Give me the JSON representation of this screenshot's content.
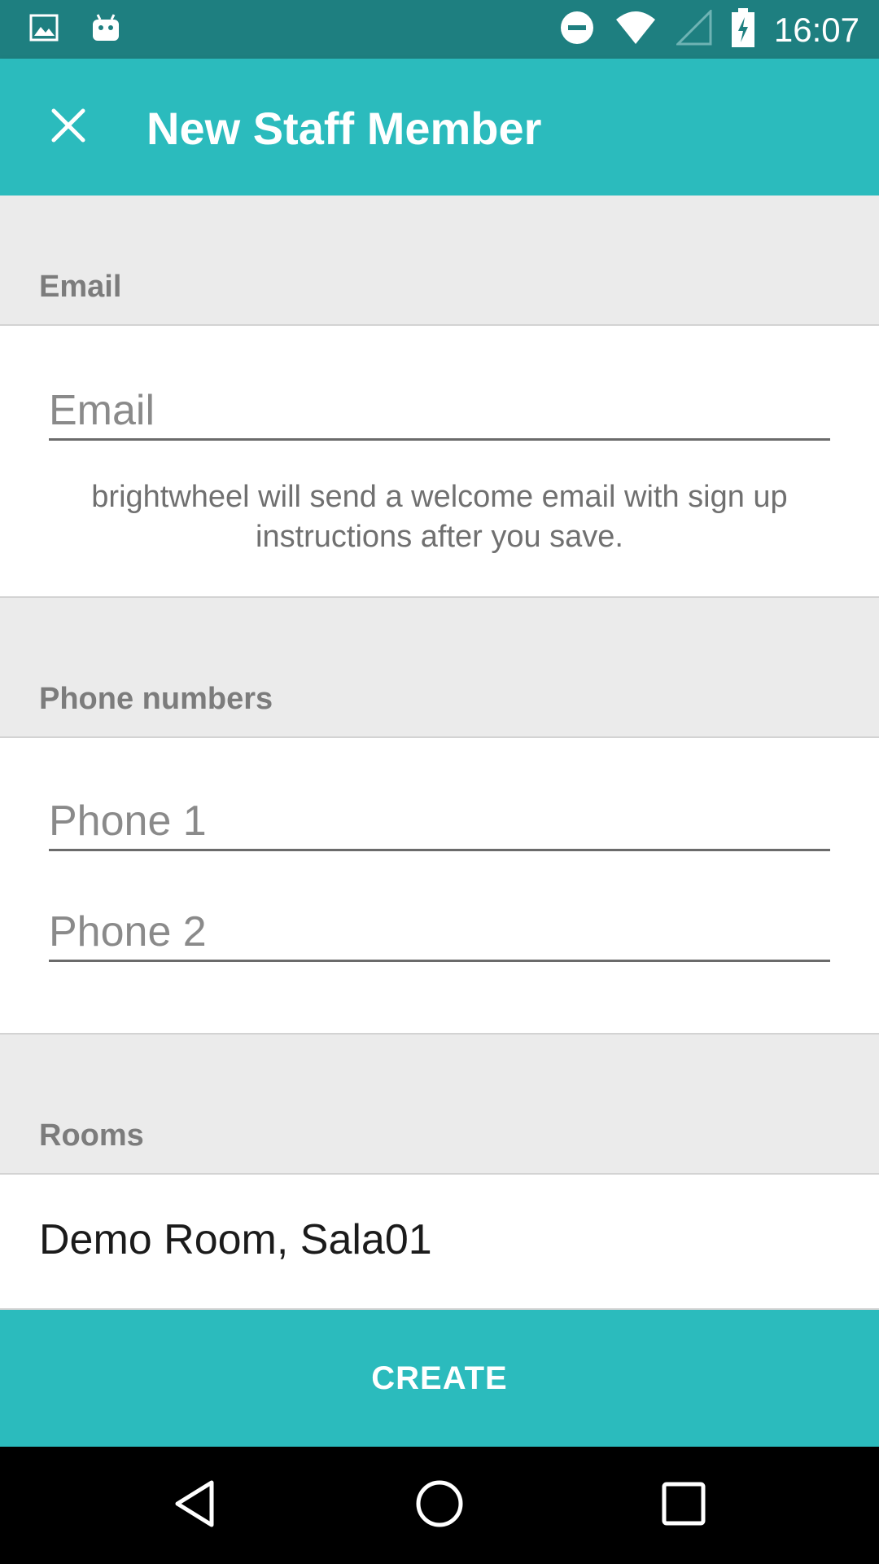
{
  "status_bar": {
    "time": "16:07",
    "icons": [
      "image-icon",
      "android-icon",
      "do-not-disturb-icon",
      "wifi-icon",
      "cell-signal-icon",
      "battery-charging-icon"
    ]
  },
  "app_bar": {
    "title": "New Staff Member",
    "close_icon": "close-icon"
  },
  "email_section": {
    "header": "Email",
    "field_placeholder": "Email",
    "field_value": "",
    "help_text": "brightwheel will send a welcome email with sign up instructions after you save."
  },
  "phone_section": {
    "header": "Phone numbers",
    "phone1_placeholder": "Phone 1",
    "phone2_placeholder": "Phone 2"
  },
  "rooms_section": {
    "header": "Rooms",
    "value": "Demo Room, Sala01"
  },
  "create_button": {
    "label": "CREATE"
  },
  "nav_bar": {
    "icons": [
      "back-icon",
      "home-icon",
      "recents-icon"
    ]
  },
  "colors": {
    "accent": "#2bbbbd",
    "status_bar": "#1e7f80",
    "section_bg": "#ebebeb"
  }
}
